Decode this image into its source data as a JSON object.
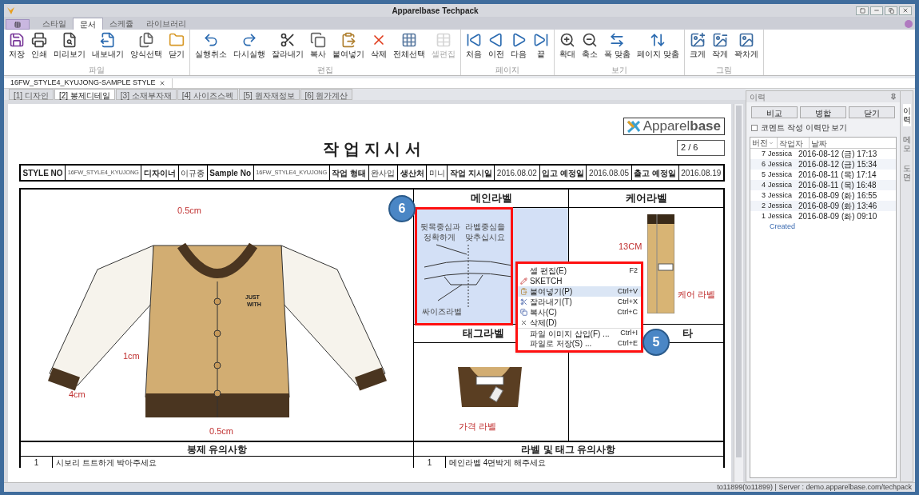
{
  "window": {
    "title": "Apparelbase Techpack"
  },
  "ribbon": {
    "tabs": [
      {
        "label": "스타일",
        "selected": false
      },
      {
        "label": "문서",
        "selected": true
      },
      {
        "label": "스케쥴",
        "selected": false
      },
      {
        "label": "라이브러리",
        "selected": false
      }
    ],
    "groups": [
      {
        "label": "파일",
        "buttons": [
          {
            "label": "저장",
            "disabled": false
          },
          {
            "label": "인쇄",
            "disabled": false
          },
          {
            "label": "미리보기",
            "disabled": false
          },
          {
            "label": "내보내기",
            "disabled": false
          },
          {
            "label": "양식선택",
            "disabled": false
          },
          {
            "label": "닫기",
            "disabled": false
          }
        ]
      },
      {
        "label": "편집",
        "buttons": [
          {
            "label": "실행취소",
            "disabled": false
          },
          {
            "label": "다시실행",
            "disabled": false
          },
          {
            "label": "잘라내기",
            "disabled": false
          },
          {
            "label": "복사",
            "disabled": false
          },
          {
            "label": "붙여넣기",
            "disabled": false
          },
          {
            "label": "삭제",
            "disabled": false
          },
          {
            "label": "전체선택",
            "disabled": false
          },
          {
            "label": "셀편집",
            "disabled": true
          }
        ]
      },
      {
        "label": "페이지",
        "buttons": [
          {
            "label": "처음",
            "disabled": false
          },
          {
            "label": "이전",
            "disabled": false
          },
          {
            "label": "다음",
            "disabled": false
          },
          {
            "label": "끝",
            "disabled": false
          }
        ]
      },
      {
        "label": "보기",
        "buttons": [
          {
            "label": "확대",
            "disabled": false
          },
          {
            "label": "축소",
            "disabled": false
          },
          {
            "label": "폭 맞춤",
            "disabled": false
          },
          {
            "label": "페이지 맞춤",
            "disabled": false
          }
        ]
      },
      {
        "label": "그림",
        "buttons": [
          {
            "label": "크게",
            "disabled": false
          },
          {
            "label": "작게",
            "disabled": false
          },
          {
            "label": "꽉차게",
            "disabled": false
          }
        ]
      }
    ]
  },
  "document_tab": {
    "title": "16FW_STYLE4_KYUJONG-SAMPLE STYLE"
  },
  "sheet_tabs": [
    {
      "label": "[1] 디자인",
      "selected": false
    },
    {
      "label": "[2] 봉제디테일",
      "selected": true
    },
    {
      "label": "[3] 소재부자재",
      "selected": false
    },
    {
      "label": "[4] 사이즈스펙",
      "selected": false
    },
    {
      "label": "[5] 원자재정보",
      "selected": false
    },
    {
      "label": "[6] 원가계산",
      "selected": false
    }
  ],
  "sheet": {
    "logo": "Apparel**base**",
    "title": "작 업 지 시 서",
    "page": "2 / 6",
    "header": [
      {
        "text": "STYLE NO",
        "kind": "label"
      },
      {
        "text": "16FW_STYLE4_KYUJONG",
        "kind": "code"
      },
      {
        "text": "디자이너",
        "kind": "label"
      },
      {
        "text": "이규종",
        "kind": "value"
      },
      {
        "text": "Sample No",
        "kind": "label"
      },
      {
        "text": "16FW_STYLE4_KYUJONG",
        "kind": "code"
      },
      {
        "text": "작업 형태",
        "kind": "label"
      },
      {
        "text": "완사입",
        "kind": "value"
      },
      {
        "text": "생산처",
        "kind": "label"
      },
      {
        "text": "미니",
        "kind": "value"
      },
      {
        "text": "작업 지시일",
        "kind": "label"
      },
      {
        "text": "2016.08.02",
        "kind": "value"
      },
      {
        "text": "입고 예정일",
        "kind": "label"
      },
      {
        "text": "2016.08.05",
        "kind": "value"
      },
      {
        "text": "출고 예정일",
        "kind": "label"
      },
      {
        "text": "2016.08.19",
        "kind": "value"
      }
    ],
    "design_notes": [
      "0.5cm",
      "JUST",
      "WITH",
      "1cm",
      "4cm",
      "0.5cm"
    ],
    "labels": [
      {
        "title": "메인라벨",
        "selected": true,
        "notes": [
          "뒷목중심과",
          "라벨중심을",
          "정확하게",
          "맞추십시요",
          "싸이즈라벨"
        ]
      },
      {
        "title": "케어라벨",
        "selected": false,
        "notes": [
          "13CM",
          "케어 라벨"
        ]
      },
      {
        "title": "태그라벨",
        "selected": false,
        "notes": [
          "가격 라벨"
        ]
      },
      {
        "title": "타",
        "selected": false
      }
    ],
    "notes_sections": [
      {
        "title": "봉제 유의사항",
        "rows": [
          {
            "no": "1",
            "text": "시보리 트트하게 박아주세요"
          }
        ]
      },
      {
        "title": "라벨 및 태그 유의사항",
        "rows": [
          {
            "no": "1",
            "text": "메인라벨 4면박게 해주세요"
          }
        ]
      }
    ]
  },
  "context_menu": [
    {
      "label": "셀 편집(E)",
      "shortcut": "F2",
      "selected": false
    },
    {
      "label": "SKETCH",
      "selected": false
    },
    {
      "label": "붙여넣기(P)",
      "shortcut": "Ctrl+V",
      "selected": true
    },
    {
      "label": "잘라내기(T)",
      "shortcut": "Ctrl+X",
      "selected": false
    },
    {
      "label": "복사(C)",
      "shortcut": "Ctrl+C",
      "selected": false
    },
    {
      "label": "삭제(D)",
      "selected": false
    },
    {
      "label": "파일 이미지 삽입(F) ...",
      "shortcut": "Ctrl+I",
      "selected": false
    },
    {
      "label": "파일로 저장(S) ...",
      "shortcut": "Ctrl+E",
      "selected": false
    }
  ],
  "callouts": [
    "6",
    "5"
  ],
  "history": {
    "title": "이력",
    "buttons": [
      "비교",
      "병합",
      "닫기"
    ],
    "filter": {
      "label": "코멘트 작성 이력만 보기",
      "checked": false
    },
    "columns": [
      "버전",
      "작업자",
      "날짜"
    ],
    "rows": [
      {
        "version": "7",
        "author": "Jessica",
        "date": "2016-08-12 (금) 17:13"
      },
      {
        "version": "6",
        "author": "Jessica",
        "date": "2016-08-12 (금) 15:34"
      },
      {
        "version": "5",
        "author": "Jessica",
        "date": "2016-08-11 (목) 17:14"
      },
      {
        "version": "4",
        "author": "Jessica",
        "date": "2016-08-11 (목) 16:48"
      },
      {
        "version": "3",
        "author": "Jessica",
        "date": "2016-08-09 (화) 16:55"
      },
      {
        "version": "2",
        "author": "Jessica",
        "date": "2016-08-09 (화) 13:46"
      },
      {
        "version": "1",
        "author": "Jessica",
        "date": "2016-08-09 (화) 09:10",
        "comment": "Created"
      }
    ],
    "side_tabs": [
      {
        "label": "이력",
        "selected": true
      },
      {
        "label": "메모",
        "selected": false
      },
      {
        "label": "도면",
        "selected": false
      }
    ]
  },
  "status_bar": "to11899(to11899) | Server : demo.apparelbase.com/techpack"
}
